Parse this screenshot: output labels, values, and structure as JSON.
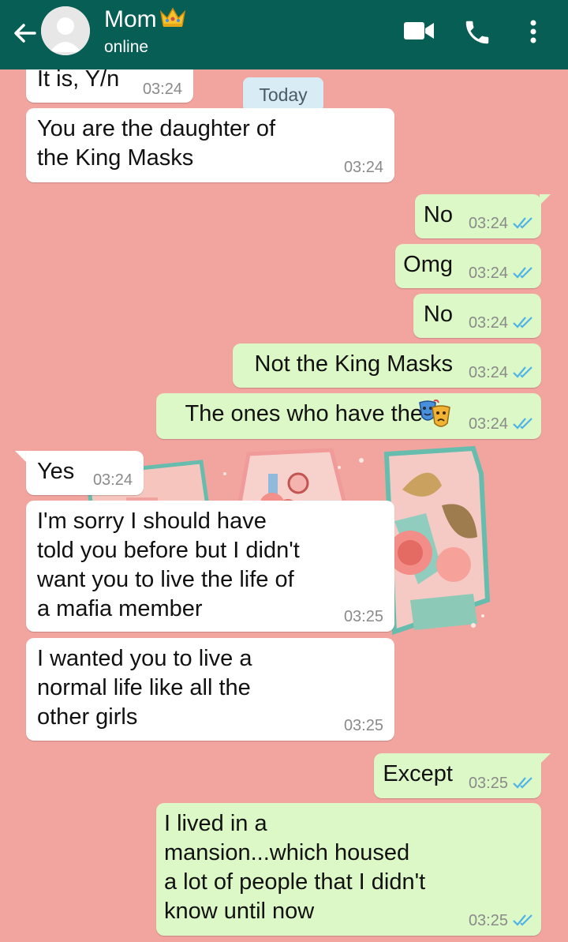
{
  "header": {
    "contact_name": "Mom",
    "status": "online"
  },
  "date_separator": "Today",
  "messages": [
    {
      "dir": "in",
      "text": "It is, Y/n",
      "time": "03:24"
    },
    {
      "dir": "in",
      "lines": [
        "You are the daughter of",
        "the King Masks"
      ],
      "time": "03:24"
    },
    {
      "dir": "out",
      "text": "No",
      "time": "03:24"
    },
    {
      "dir": "out",
      "text": "Omg",
      "time": "03:24"
    },
    {
      "dir": "out",
      "text": "No",
      "time": "03:24"
    },
    {
      "dir": "out",
      "text": "Not the King Masks",
      "time": "03:24"
    },
    {
      "dir": "out",
      "text": "The ones who have the",
      "emoji": "performing-arts-emoji",
      "time": "03:24"
    },
    {
      "dir": "in",
      "text": "Yes",
      "time": "03:24"
    },
    {
      "dir": "in",
      "lines": [
        "I'm sorry I should have",
        "told you before but I didn't",
        "want you to live the life of",
        "a mafia member"
      ],
      "time": "03:25"
    },
    {
      "dir": "in",
      "lines": [
        "I wanted you to live a",
        "normal life like all the",
        "other girls"
      ],
      "time": "03:25"
    },
    {
      "dir": "out",
      "text": "Except",
      "time": "03:25"
    },
    {
      "dir": "out",
      "lines": [
        "I lived in a",
        "mansion...which housed",
        "a lot of people that I didn't",
        "know until now"
      ],
      "time": "03:25"
    }
  ],
  "colors": {
    "header_bg": "#075e54",
    "wallpaper": "#f2a49f",
    "incoming_bubble": "#ffffff",
    "outgoing_bubble": "#dcf8c6",
    "read_ticks": "#4fb3e8"
  },
  "icons": {
    "back": "arrow-left-icon",
    "crown": "crown-emoji",
    "video": "video-camera-icon",
    "call": "phone-icon",
    "menu": "kebab-menu-icon"
  }
}
